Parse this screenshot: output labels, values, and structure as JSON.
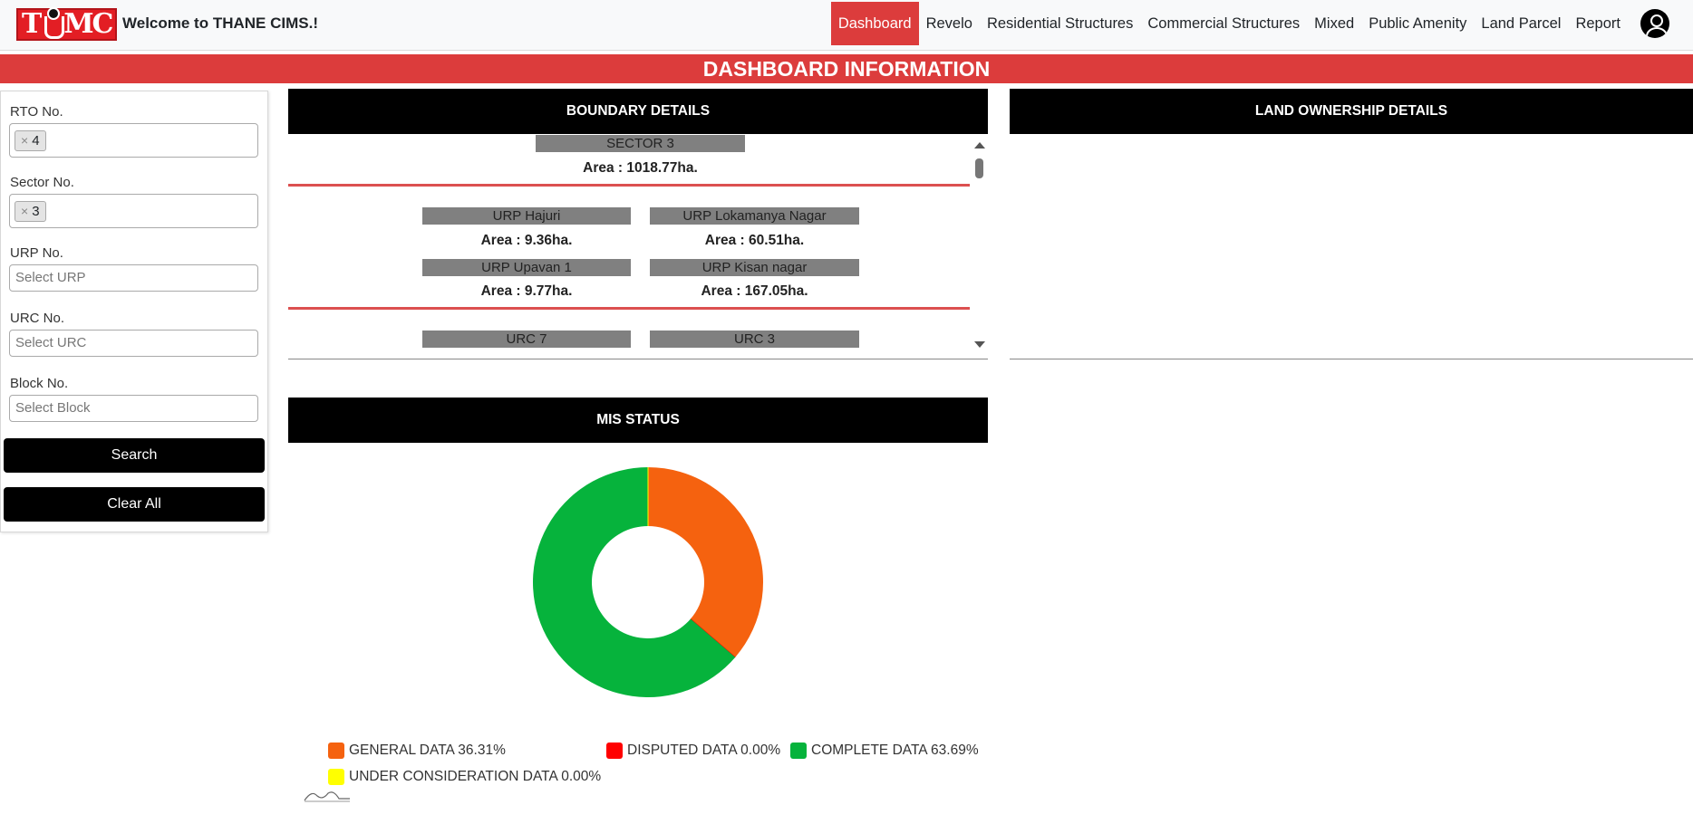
{
  "header": {
    "logo_text": "TMC",
    "welcome": "Welcome to THANE CIMS.!",
    "nav": [
      {
        "label": "Dashboard",
        "active": true
      },
      {
        "label": "Revelo",
        "active": false
      },
      {
        "label": "Residential Structures",
        "active": false
      },
      {
        "label": "Commercial Structures",
        "active": false
      },
      {
        "label": "Mixed",
        "active": false
      },
      {
        "label": "Public Amenity",
        "active": false
      },
      {
        "label": "Land Parcel",
        "active": false
      },
      {
        "label": "Report",
        "active": false
      }
    ],
    "user_icon": "user-circle-icon"
  },
  "dashboard_title": "DASHBOARD INFORMATION",
  "filters": {
    "rto": {
      "label": "RTO No.",
      "selected": "4",
      "remove": "×"
    },
    "sector": {
      "label": "Sector No.",
      "selected": "3",
      "remove": "×"
    },
    "urp": {
      "label": "URP No.",
      "placeholder": "Select URP"
    },
    "urc": {
      "label": "URC No.",
      "placeholder": "Select URC"
    },
    "block": {
      "label": "Block No.",
      "placeholder": "Select Block"
    },
    "search_label": "Search",
    "clear_label": "Clear All"
  },
  "boundary": {
    "title": "BOUNDARY DETAILS",
    "sector": {
      "name": "SECTOR 3",
      "area": "Area : 1018.77ha."
    },
    "urps": [
      {
        "name": "URP Hajuri",
        "area": "Area : 9.36ha."
      },
      {
        "name": "URP Lokamanya Nagar",
        "area": "Area : 60.51ha."
      },
      {
        "name": "URP Upavan 1",
        "area": "Area : 9.77ha."
      },
      {
        "name": "URP Kisan nagar",
        "area": "Area : 167.05ha."
      }
    ],
    "urcs": [
      {
        "name": "URC 7"
      },
      {
        "name": "URC 3"
      }
    ]
  },
  "land_ownership": {
    "title": "LAND OWNERSHIP DETAILS"
  },
  "mis": {
    "title": "MIS STATUS",
    "legend": [
      {
        "label": "GENERAL DATA 36.31%",
        "color": "#f5620f"
      },
      {
        "label": "DISPUTED DATA 0.00%",
        "color": "#ff0000"
      },
      {
        "label": "COMPLETE DATA 63.69%",
        "color": "#06b33c"
      },
      {
        "label": "UNDER CONSIDERATION DATA 0.00%",
        "color": "#ffff00"
      }
    ]
  },
  "chart_data": {
    "type": "pie",
    "categories": [
      "GENERAL DATA",
      "DISPUTED DATA",
      "COMPLETE DATA",
      "UNDER CONSIDERATION DATA"
    ],
    "values": [
      36.31,
      0.0,
      63.69,
      0.0
    ],
    "colors": [
      "#f5620f",
      "#ff0000",
      "#06b33c",
      "#ffff00"
    ],
    "donut": true,
    "legend": "bottom"
  }
}
